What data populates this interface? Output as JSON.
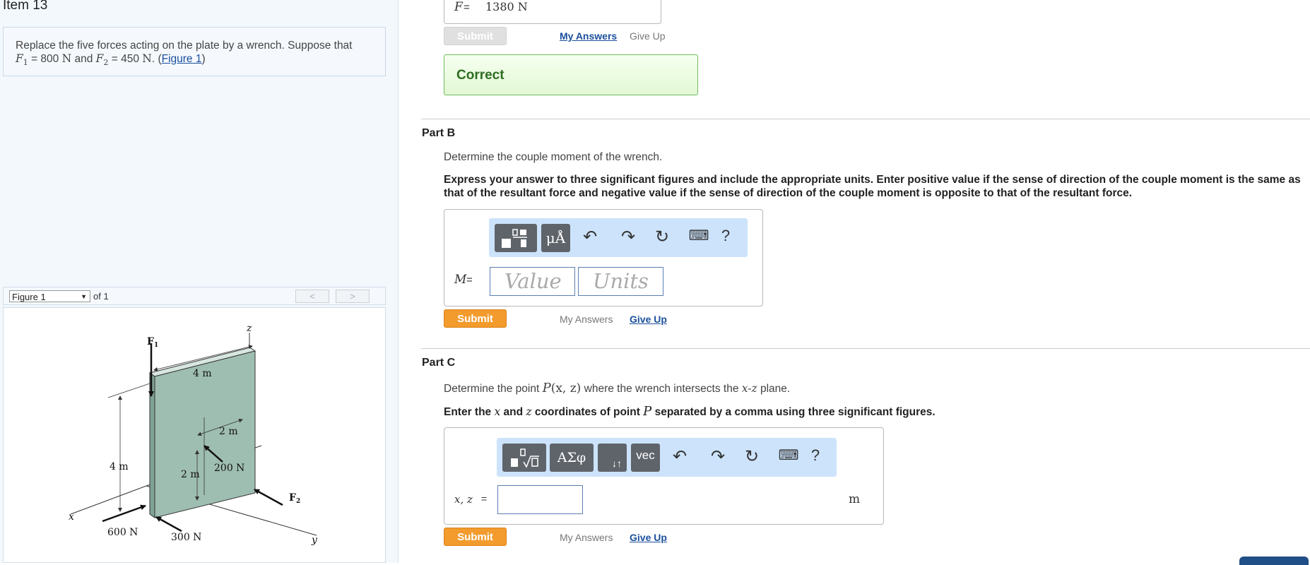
{
  "item": {
    "title": "Item 13"
  },
  "problem": {
    "text1": "Replace the five forces acting on the plate by a wrench. Suppose that",
    "f1_sym": "F",
    "f1_sub": "1",
    "f1_val": " = 800  ",
    "unit_N": "N",
    "and": " and ",
    "f2_sym": "F",
    "f2_sub": "2",
    "f2_val": " = 450  ",
    "paren_open": ". (",
    "figure_link": "Figure 1",
    "paren_close": ")"
  },
  "figure_nav": {
    "selected": "Figure 1",
    "of": "of 1",
    "prev": "<",
    "next": ">"
  },
  "figure": {
    "labels": {
      "F1": "F",
      "F1_sub": "1",
      "F2": "F",
      "F2_sub": "2",
      "z": "z",
      "x": "x",
      "y": "y",
      "w4": "4 m",
      "h4": "4 m",
      "d2a": "2 m",
      "d2b": "2 m",
      "f200": "200 N",
      "f600": "600 N",
      "f300": "300 N"
    }
  },
  "partA": {
    "var": "F",
    "eq": " =",
    "value": "1380 N",
    "submit": "Submit",
    "my_answers": "My Answers",
    "give_up": "Give Up",
    "status": "Correct"
  },
  "partB": {
    "title": "Part B",
    "question": "Determine the couple moment of the wrench.",
    "instruction": "Express your answer to three significant figures and include the appropriate units. Enter positive value if the sense of direction of the couple moment is the same as that of the resultant force and negative value if the sense of direction of the couple moment is opposite to that of the resultant force.",
    "var": "M",
    "eq": " =",
    "value_placeholder": "Value",
    "units_placeholder": "Units",
    "toolbar": {
      "units_btn": "μÅ",
      "help": "?"
    },
    "submit": "Submit",
    "my_answers": "My Answers",
    "give_up": "Give Up"
  },
  "partC": {
    "title": "Part C",
    "q_pre": "Determine the point ",
    "q_P": "P",
    "q_args": "(x, z)",
    "q_mid": " where the wrench intersects the ",
    "q_plane": "x-z",
    "q_post": " plane.",
    "i_pre": "Enter the ",
    "i_x": "x",
    "i_and": " and ",
    "i_z": "z",
    "i_mid": " coordinates of point ",
    "i_P": "P",
    "i_post": " separated by a comma using three significant figures.",
    "var": "x, z",
    "eq": " =",
    "unit": "m",
    "toolbar": {
      "greek_btn": "ΑΣφ",
      "vec_btn": "vec",
      "help": "?"
    },
    "submit": "Submit",
    "my_answers": "My Answers",
    "give_up": "Give Up"
  },
  "colors": {
    "accent_orange": "#f39b2c",
    "link_blue": "#1a4f9c",
    "correct_green": "#2c6d20",
    "plate": "#9fbeb2"
  }
}
